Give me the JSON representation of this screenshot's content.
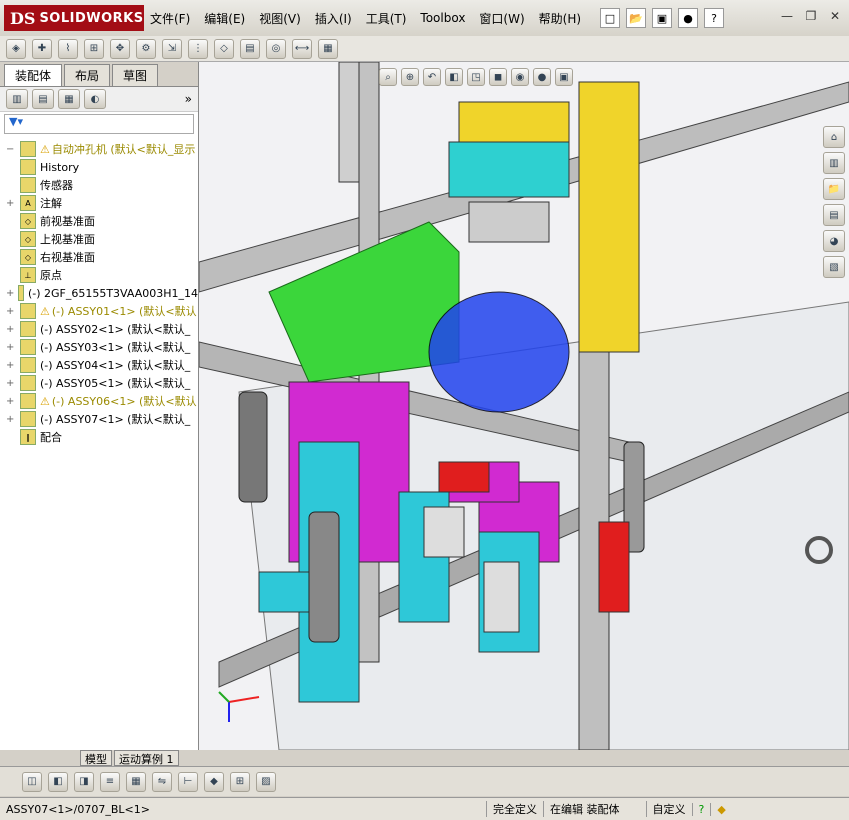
{
  "app": {
    "logo_ds": "DS",
    "logo_text": "SOLIDWORKS"
  },
  "menu": [
    "文件(F)",
    "编辑(E)",
    "视图(V)",
    "插入(I)",
    "工具(T)",
    "Toolbox",
    "窗口(W)",
    "帮助(H)"
  ],
  "panel": {
    "tabs": [
      "装配体",
      "布局",
      "草图"
    ],
    "tree": [
      {
        "label": "自动冲孔机  (默认<默认_显示",
        "warn": true,
        "yellow": true
      },
      {
        "label": "History"
      },
      {
        "label": "传感器"
      },
      {
        "label": "注解"
      },
      {
        "label": "前视基准面"
      },
      {
        "label": "上视基准面"
      },
      {
        "label": "右视基准面"
      },
      {
        "label": "原点"
      },
      {
        "label": "(-) 2GF_65155T3VAA003H1_14"
      },
      {
        "label": "(-) ASSY01<1> (默认<默认",
        "warn": true,
        "yellow": true
      },
      {
        "label": "(-) ASSY02<1> (默认<默认_"
      },
      {
        "label": "(-) ASSY03<1> (默认<默认_"
      },
      {
        "label": "(-) ASSY04<1> (默认<默认_"
      },
      {
        "label": "(-) ASSY05<1> (默认<默认_"
      },
      {
        "label": "(-) ASSY06<1> (默认<默认",
        "warn": true,
        "yellow": true
      },
      {
        "label": "(-) ASSY07<1> (默认<默认_"
      },
      {
        "label": "配合"
      }
    ],
    "bottom_tabs": [
      "模型",
      "运动算例 1"
    ]
  },
  "status": {
    "left": "ASSY07<1>/0707_BL<1>",
    "state": "完全定义",
    "mode": "在编辑 装配体",
    "custom": "自定义"
  }
}
